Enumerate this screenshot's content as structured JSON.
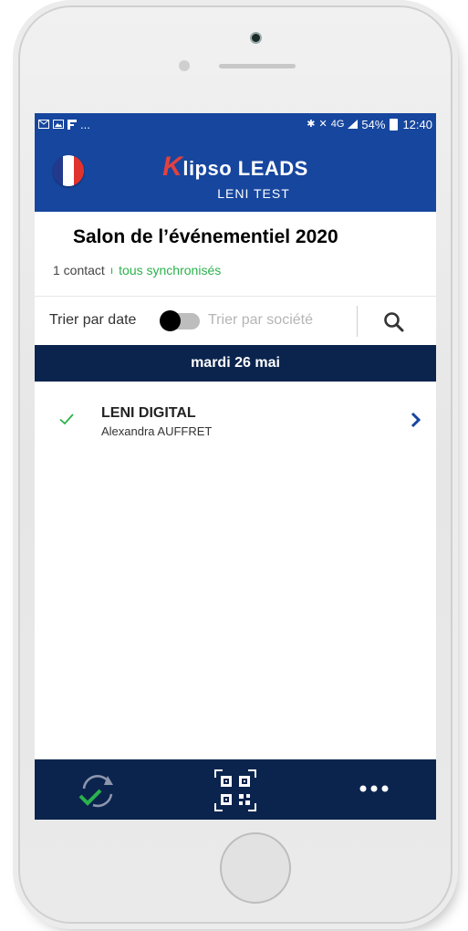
{
  "status_bar": {
    "left_icons": [
      "mail-icon",
      "image-icon",
      "notification-icon"
    ],
    "left_ellipsis": "...",
    "network_label": "4G",
    "battery_text": "54%",
    "time": "12:40"
  },
  "header": {
    "brand_k": "K",
    "brand_rest": "lipso LEADS",
    "subtitle": "LENI TEST",
    "language_flag": "france-flag"
  },
  "event": {
    "title": "Salon de l’événementiel 2020",
    "contacts_count": "1 contact",
    "separator": "ı",
    "sync_status": "tous synchronisés"
  },
  "sort": {
    "by_date_label": "Trier par date",
    "by_company_label": "Trier par société",
    "toggle_state": "date"
  },
  "list": {
    "date_header": "mardi 26 mai",
    "contacts": [
      {
        "company": "LENI DIGITAL",
        "name": "Alexandra AUFFRET",
        "synced": true
      }
    ]
  },
  "bottom_nav": {
    "items": [
      "sync-icon",
      "qr-code-icon",
      "more-icon"
    ]
  },
  "colors": {
    "brand_blue": "#17469e",
    "dark_navy": "#0b244e",
    "accent_red": "#e2413f",
    "sync_green": "#2bb24c"
  }
}
